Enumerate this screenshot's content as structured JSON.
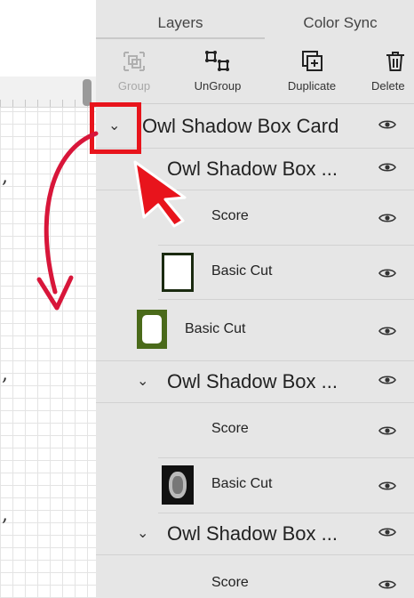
{
  "tabs": {
    "layers": "Layers",
    "color_sync": "Color Sync"
  },
  "toolbar": {
    "group": "Group",
    "ungroup": "UnGroup",
    "duplicate": "Duplicate",
    "delete": "Delete"
  },
  "layers": {
    "r1": "Owl Shadow Box Card",
    "r2": "Owl Shadow Box ...",
    "r3": "Score",
    "r4": "Basic Cut",
    "r5": "Basic Cut",
    "r6": "Owl Shadow Box ...",
    "r7": "Score",
    "r8": "Basic Cut",
    "r9": "Owl Shadow Box ...",
    "r10": "Score"
  },
  "icons": {
    "visibility": "eye-icon",
    "expand": "chevron-down-icon"
  },
  "colors": {
    "panel_bg": "#e6e6e6",
    "highlight": "#e8141c",
    "thumb_green": "#4a6a1a",
    "thumb_dark": "#1a2a10"
  }
}
